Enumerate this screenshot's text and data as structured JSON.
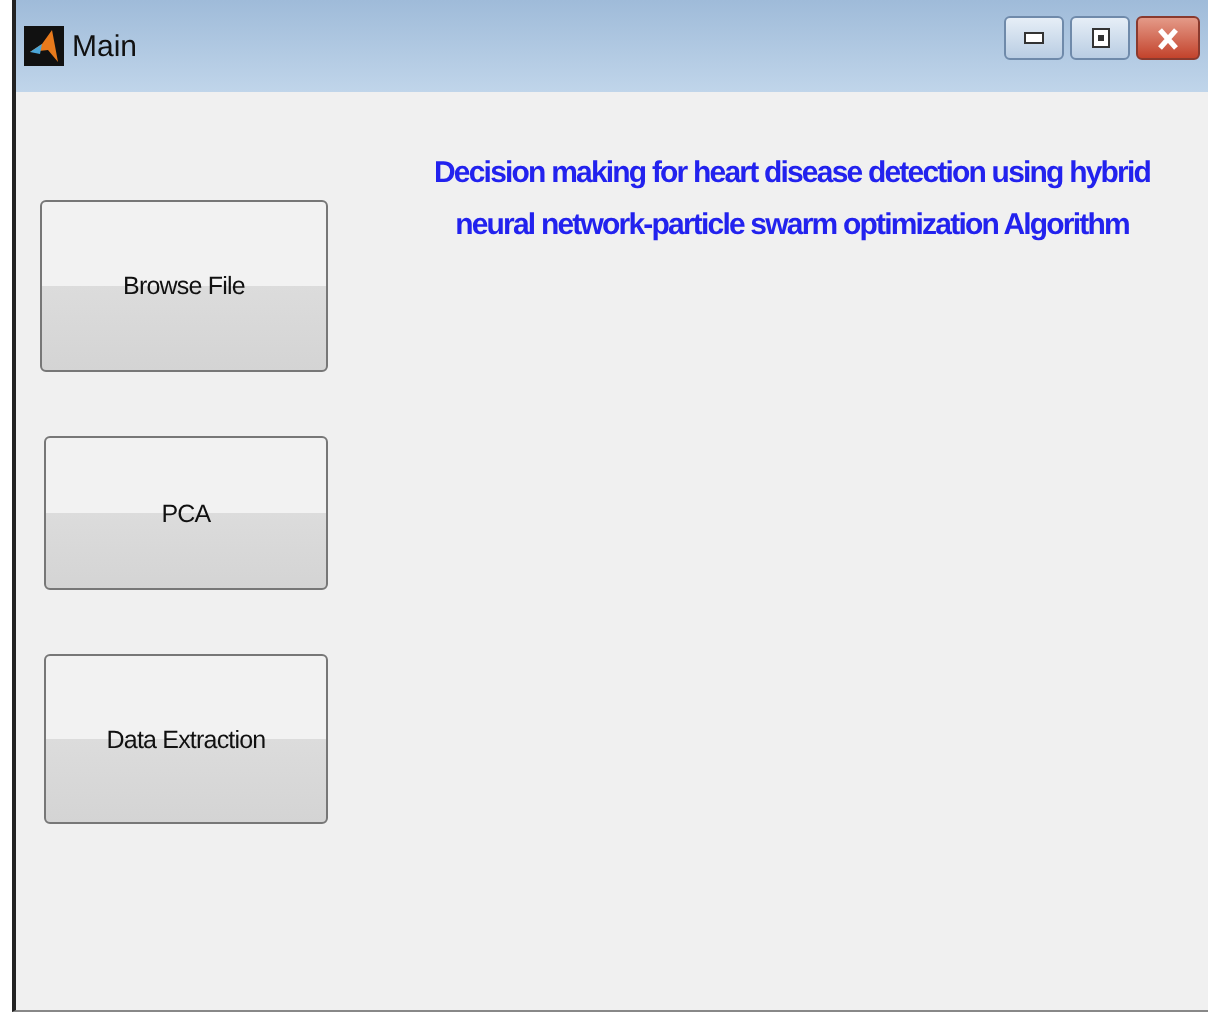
{
  "window": {
    "title": "Main"
  },
  "heading": "Decision making for heart disease detection using hybrid neural network-particle swarm optimization Algorithm",
  "buttons": [
    {
      "label": "Browse File"
    },
    {
      "label": "PCA"
    },
    {
      "label": "Data Extraction"
    }
  ]
}
